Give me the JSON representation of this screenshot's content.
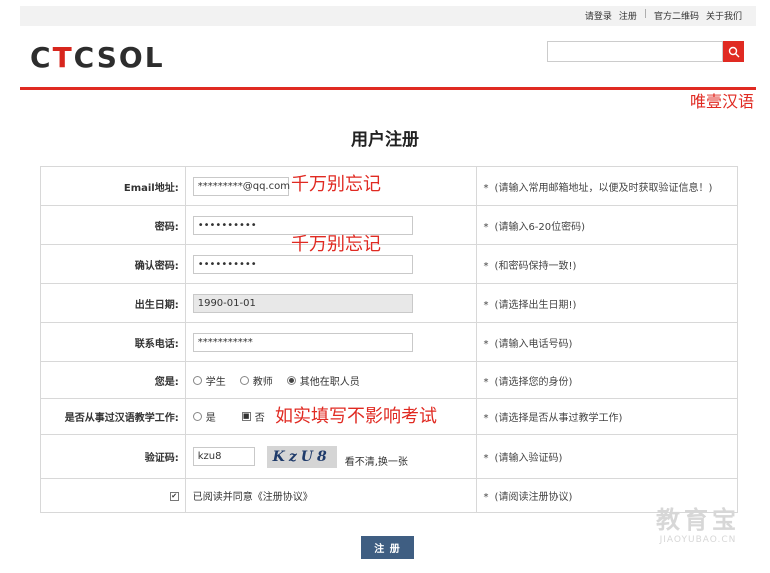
{
  "topnav": {
    "login": "请登录",
    "register": "注册",
    "separator": "|",
    "qrcode": "官方二维码",
    "about": "关于我们"
  },
  "logo": {
    "part1": "C",
    "part2": "T",
    "part3": "CSOL"
  },
  "search": {
    "placeholder": ""
  },
  "watermark_top": "唯壹汉语",
  "page_title": "用户注册",
  "fields": {
    "email": {
      "label": "Email地址:",
      "value": "*********@qq.com",
      "hint": "(请输入常用邮箱地址，以便及时获取验证信息！)"
    },
    "password": {
      "label": "密码:",
      "value": "••••••••••",
      "hint": "(请输入6-20位密码)"
    },
    "confirm_password": {
      "label": "确认密码:",
      "value": "••••••••••",
      "hint": "(和密码保持一致!)"
    },
    "birthdate": {
      "label": "出生日期:",
      "value": "1990-01-01",
      "hint": "(请选择出生日期!)"
    },
    "phone": {
      "label": "联系电话:",
      "value": "***********",
      "hint": "(请输入电话号码)"
    },
    "identity": {
      "label": "您是:",
      "options": [
        "学生",
        "教师",
        "其他在职人员"
      ],
      "selected_index": 2,
      "hint": "(请选择您的身份)"
    },
    "teaching": {
      "label": "是否从事过汉语教学工作:",
      "yes": "是",
      "no": "否",
      "hint": "(请选择是否从事过教学工作)"
    },
    "captcha": {
      "label": "验证码:",
      "value": "kzu8",
      "image_text": "KzU8",
      "refresh": "看不清,换一张",
      "hint": "(请输入验证码)"
    },
    "agreement": {
      "text": "已阅读并同意《注册协议》",
      "hint": "(请阅读注册协议)"
    }
  },
  "required_mark": "*",
  "annotations": {
    "note1": "千万别忘记",
    "note2": "千万别忘记",
    "note3": "如实填写不影响考试"
  },
  "submit_label": "注 册",
  "watermark_bottom": {
    "cn": "教育宝",
    "en": "JIAOYUBAO.CN"
  },
  "colors": {
    "accent": "#e02a22",
    "button": "#3f5e82"
  }
}
